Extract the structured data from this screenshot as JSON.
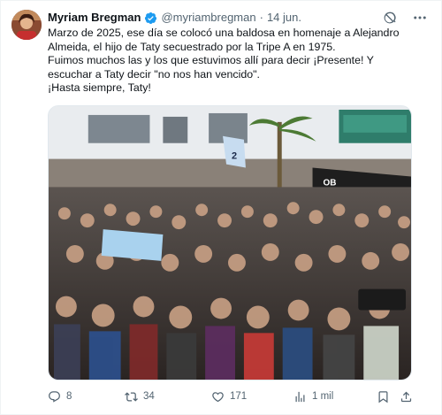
{
  "tweet": {
    "author_name": "Myriam Bregman",
    "handle": "@myriambregman",
    "separator": "·",
    "date": "14 jun.",
    "lines": [
      "Marzo de 2025, ese día se colocó una baldosa en homenaje a Alejandro",
      "Almeida, el hijo de Taty secuestrado por la Tripe A en 1975.",
      "Fuimos muchos las y los que estuvimos allí para decir ¡Presente! Y",
      "escuchar a Taty decir \"no nos han vencido\".",
      "¡Hasta siempre, Taty!"
    ],
    "banner_text": "OB",
    "flag_text": "2",
    "icons": {
      "verified": "verified-badge-icon",
      "grok": "grok-icon",
      "more": "more-icon"
    }
  },
  "actions": {
    "reply_count": "8",
    "retweet_count": "34",
    "like_count": "171",
    "views_count": "1 mil"
  },
  "colors": {
    "accent": "#1d9bf0",
    "secondary_text": "#536471",
    "primary_text": "#0f1419"
  }
}
